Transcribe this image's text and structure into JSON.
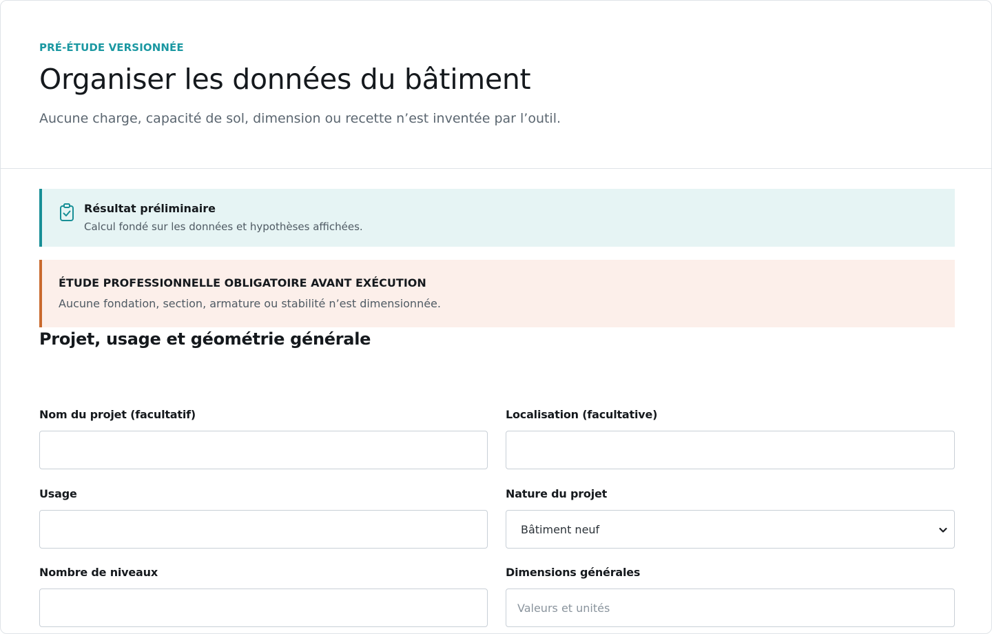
{
  "header": {
    "kicker": "PRÉ-ÉTUDE VERSIONNÉE",
    "title": "Organiser les données du bâtiment",
    "subtitle": "Aucune charge, capacité de sol, dimension ou recette n’est inventée par l’outil."
  },
  "notices": {
    "info": {
      "icon": "clipboard-check-icon",
      "title": "Résultat préliminaire",
      "text": "Calcul fondé sur les données et hypothèses affichées.",
      "accent": "#188f96",
      "background": "#e6f4f4"
    },
    "warning": {
      "title": "ÉTUDE PROFESSIONNELLE OBLIGATOIRE AVANT EXÉCUTION",
      "text": "Aucune fondation, section, armature ou stabilité n’est dimensionnée.",
      "accent": "#c96a2e",
      "background": "#fcefea"
    }
  },
  "section": {
    "title": "Projet, usage et géométrie générale"
  },
  "form": {
    "project_name": {
      "label": "Nom du projet (facultatif)",
      "value": "",
      "placeholder": ""
    },
    "location": {
      "label": "Localisation (facultative)",
      "value": "",
      "placeholder": ""
    },
    "usage": {
      "label": "Usage",
      "value": "",
      "placeholder": ""
    },
    "nature": {
      "label": "Nature du projet",
      "selected": "Bâtiment neuf"
    },
    "levels": {
      "label": "Nombre de niveaux",
      "value": "",
      "placeholder": ""
    },
    "dimensions": {
      "label": "Dimensions générales",
      "value": "",
      "placeholder": "Valeurs et unités"
    }
  },
  "colors": {
    "kicker": "#1b98a2",
    "border": "#c8cfd6"
  }
}
